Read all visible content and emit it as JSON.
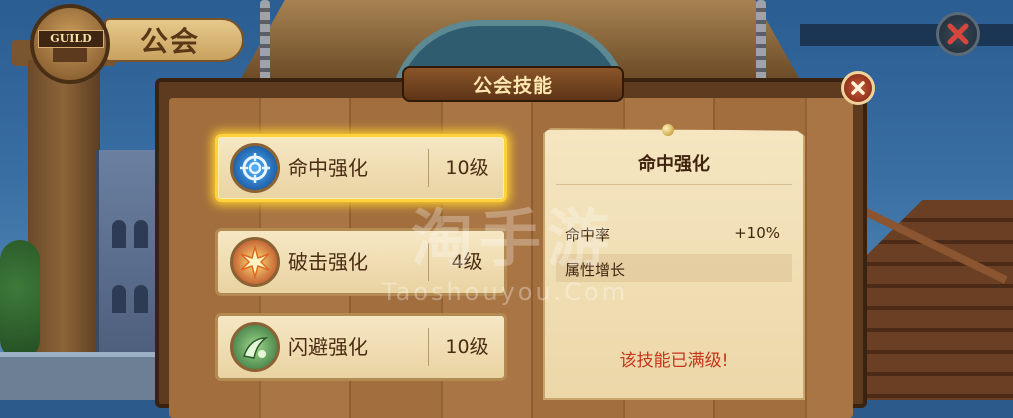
{
  "header": {
    "guild_badge": "GUILD",
    "page_title": "公会"
  },
  "panel": {
    "title": "公会技能"
  },
  "skills": [
    {
      "name": "命中强化",
      "level": "10级",
      "icon": "target-icon",
      "selected": true
    },
    {
      "name": "破击强化",
      "level": "4级",
      "icon": "burst-icon",
      "selected": false
    },
    {
      "name": "闪避强化",
      "level": "10级",
      "icon": "dodge-icon",
      "selected": false
    }
  ],
  "detail": {
    "title": "命中强化",
    "stat_label": "命中率",
    "stat_value": "+10%",
    "growth_label": "属性增长",
    "status": "该技能已满级!"
  },
  "watermark": {
    "main": "淘手游",
    "sub": "Taoshouyou.Com"
  },
  "colors": {
    "selected_glow": "#ffcf2e",
    "maxed_text": "#c3361a",
    "panel_title": "#ffe7b0"
  }
}
